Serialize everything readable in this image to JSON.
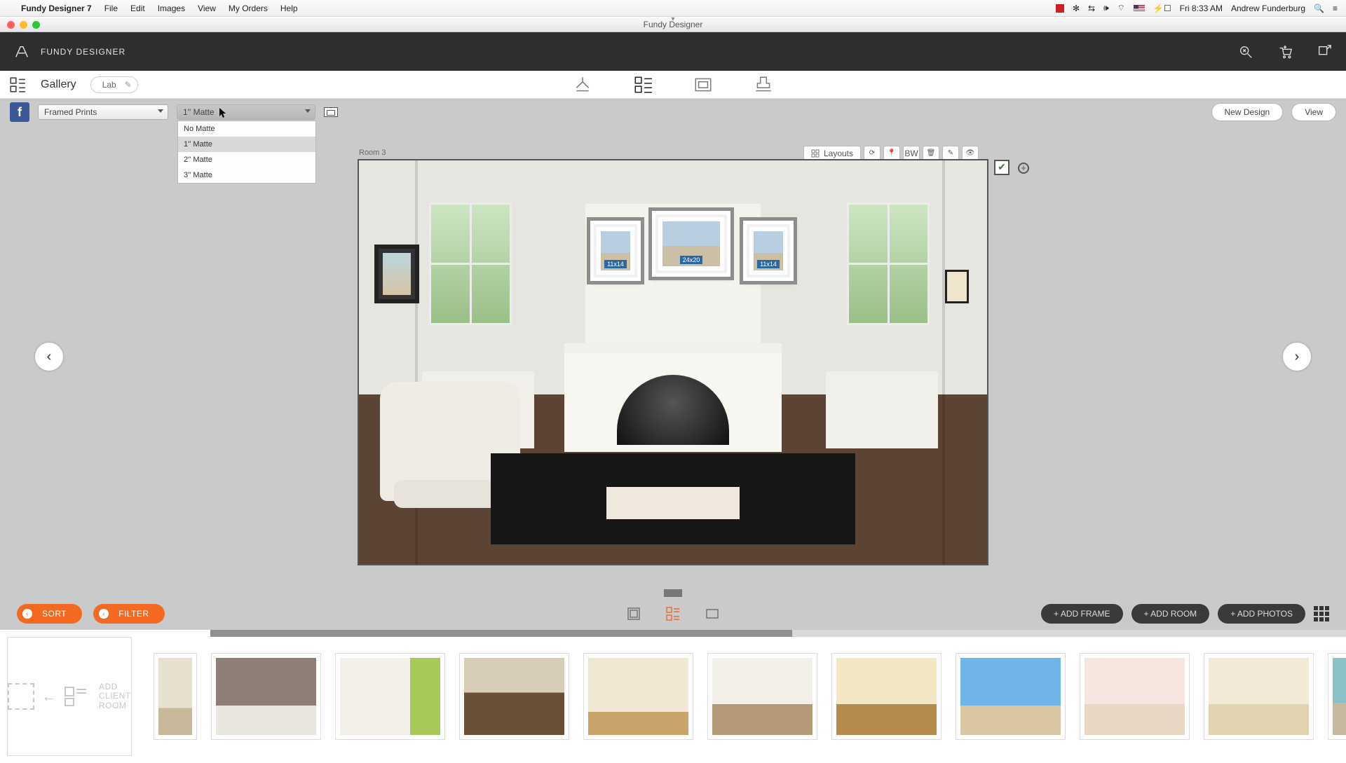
{
  "mac_menu": {
    "app": "Fundy Designer 7",
    "items": [
      "File",
      "Edit",
      "Images",
      "View",
      "My Orders",
      "Help"
    ],
    "time": "Fri 8:33 AM",
    "user": "Andrew Funderburg"
  },
  "window": {
    "title": "Fundy Designer"
  },
  "header": {
    "brand": "FUNDY DESIGNER"
  },
  "toolbar": {
    "section": "Gallery",
    "chip": "Lab"
  },
  "dropdowns": {
    "product": "Framed Prints",
    "matte_selected": "1'' Matte",
    "matte_options": [
      "No Matte",
      "1'' Matte",
      "2'' Matte",
      "3'' Matte"
    ]
  },
  "buttons": {
    "new_design": "New Design",
    "view": "View",
    "layouts": "Layouts",
    "bw": "BW",
    "sort": "SORT",
    "filter": "FILTER",
    "add_frame": "+ ADD FRAME",
    "add_room": "+ ADD ROOM",
    "add_photos": "+ ADD PHOTOS"
  },
  "room": {
    "label": "Room 3",
    "frames": [
      {
        "size": "11x14"
      },
      {
        "size": "24x20"
      },
      {
        "size": "11x14"
      }
    ]
  },
  "filmstrip": {
    "add_client_line1": "ADD CLIENT",
    "add_client_line2": "ROOM"
  }
}
